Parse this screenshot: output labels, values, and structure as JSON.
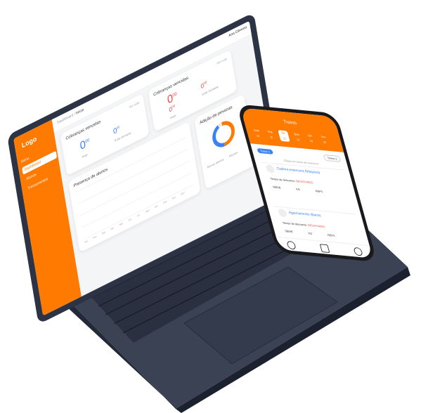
{
  "laptop": {
    "sidebar": {
      "logo": "Logo",
      "menu_label": "Menu",
      "items": [
        {
          "label": "Dashboard"
        },
        {
          "label": "Alunos"
        },
        {
          "label": "Treinamentos"
        }
      ]
    },
    "topbar": {
      "crumb_root": "Dashboard",
      "crumb_current": "Início",
      "user_name": "Ana Oliveira"
    },
    "cards": {
      "cobrancas_left": {
        "title": "Cobranças vencidas",
        "value": "0",
        "value_suffix": "00",
        "sub1": "Hoje",
        "sub2_value": "0",
        "sub2_suffix": "00",
        "sub2_label": "Esta semana",
        "link": "Ver tudo"
      },
      "cobrancas_right": {
        "title": "Cobranças vencidas",
        "value": "0",
        "value_suffix": "00",
        "small_left": "0",
        "small_left_suffix": "00",
        "small_left_label": "Hoje",
        "small_right": "0",
        "small_right_suffix": "00",
        "small_right_label": "Esta semana",
        "link": "Ver tudo"
      },
      "presenca": {
        "title": "Presença de alunos",
        "months": [
          "Jan",
          "Fev",
          "Mar",
          "Abr",
          "Mai",
          "Jun",
          "Jul",
          "Ago",
          "Set",
          "Out",
          "Nov",
          "Dez"
        ]
      },
      "adicao": {
        "title": "Adição de pessoas",
        "legend": [
          "Novos alunos",
          "Alunos"
        ]
      }
    },
    "colors": {
      "accent": "#ff7a00",
      "blue": "#3b82f6",
      "red": "#ef4444",
      "frame": "#2b3345"
    }
  },
  "phone": {
    "title": "Treino",
    "days": [
      {
        "label": "Dom",
        "num": "10"
      },
      {
        "label": "Seg",
        "num": "11"
      },
      {
        "label": "Ter",
        "num": "12"
      },
      {
        "label": "Qua",
        "num": "13"
      },
      {
        "label": "Qui",
        "num": "14"
      },
      {
        "label": "Sex",
        "num": "15"
      }
    ],
    "pill_left": "Treino 1",
    "pill_right": "Treino 2",
    "hint": "Clique em nome de exercício",
    "exercises": [
      {
        "name": "Cadeira extensora (Máquina)",
        "rest_label": "Tempo de descanso:",
        "rest_value": "DESATIVADO",
        "cols": [
          "SÉRIE",
          "KG",
          "REPS"
        ]
      },
      {
        "name": "Agachamento (Barra)",
        "rest_label": "Tempo de descanso:",
        "rest_value": "DESATIVADO",
        "cols": [
          "SÉRIE",
          "KG",
          "REPS"
        ]
      }
    ]
  }
}
